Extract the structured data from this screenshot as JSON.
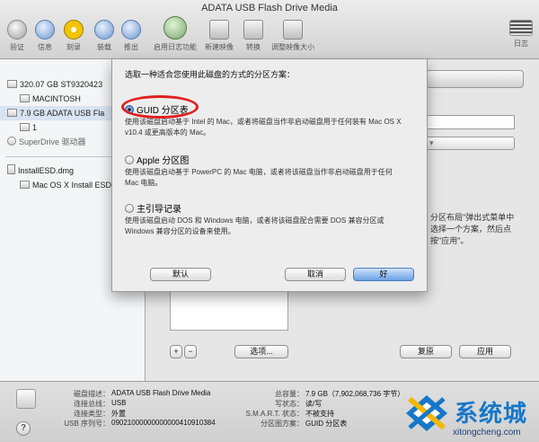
{
  "window": {
    "title": "ADATA USB Flash Drive Media"
  },
  "toolbar": {
    "items": [
      {
        "label": "验证",
        "icon": "microscope-icon"
      },
      {
        "label": "信息",
        "icon": "info-icon"
      },
      {
        "label": "刻录",
        "icon": "burn-icon"
      },
      {
        "label": "装载",
        "icon": "mount-icon"
      },
      {
        "label": "推出",
        "icon": "eject-icon"
      },
      {
        "label": "启用日志功能",
        "icon": "journal-icon"
      },
      {
        "label": "新建映像",
        "icon": "new-image-icon"
      },
      {
        "label": "转换",
        "icon": "convert-icon"
      },
      {
        "label": "调整映像大小",
        "icon": "resize-image-icon"
      }
    ],
    "log_label": "日志"
  },
  "sidebar": {
    "items": [
      {
        "label": "320.07 GB ST9320423",
        "selected": false
      },
      {
        "label": "MACINTOSH",
        "selected": false
      },
      {
        "label": "7.9 GB ADATA USB Fla",
        "selected": true
      },
      {
        "label": "1",
        "selected": false
      },
      {
        "label": "SuperDrive 驱动器",
        "selected": false
      },
      {
        "label": "InstallESD.dmg",
        "selected": false
      },
      {
        "label": "Mac OS X Install ESD",
        "selected": false
      }
    ]
  },
  "main": {
    "options_button": "选项...",
    "revert_button": "复原",
    "apply_button": "应用",
    "add_button": "+",
    "remove_button": "−",
    "hint_text": "分区布局\"弹出式菜单中选择一个方案，然后点按\"应用\"。"
  },
  "sheet": {
    "prompt": "选取一种适合您使用此磁盘的方式的分区方案：",
    "options": [
      {
        "title": "GUID 分区表",
        "selected": true,
        "desc": "使用该磁盘启动基于 Intel 的 Mac，或者将磁盘当作非启动磁盘用于任何装有 Mac OS X v10.4 或更高版本的 Mac。"
      },
      {
        "title": "Apple 分区图",
        "selected": false,
        "desc": "使用该磁盘启动基于 PowerPC 的 Mac 电脑，或者将该磁盘当作非启动磁盘用于任何 Mac 电脑。"
      },
      {
        "title": "主引导记录",
        "selected": false,
        "desc": "使用该磁盘启动 DOS 和 Windows 电脑，或者将该磁盘配合需要 DOS 兼容分区或 Windows 兼容分区的设备来使用。"
      }
    ],
    "default_button": "默认",
    "cancel_button": "取消",
    "ok_button": "好",
    "highlight_color": "#e0201f"
  },
  "info": {
    "left": [
      {
        "label": "磁盘描述：",
        "value": "ADATA USB Flash Drive Media"
      },
      {
        "label": "连接总线：",
        "value": "USB"
      },
      {
        "label": "连接类型：",
        "value": "外置"
      },
      {
        "label": "USB 序列号：",
        "value": "09021000000000000410910384"
      }
    ],
    "right": [
      {
        "label": "总容量：",
        "value": "7.9 GB（7,902,068,736 字节）"
      },
      {
        "label": "写状态：",
        "value": "读/写"
      },
      {
        "label": "S.M.A.R.T. 状态：",
        "value": "不被支持"
      },
      {
        "label": "分区图方案：",
        "value": "GUID 分区表"
      }
    ]
  },
  "watermark": {
    "title": "系统城",
    "url": "xitongcheng.com"
  },
  "colors": {
    "accent": "#3f7fd0",
    "watermark_blue": "#1577c9",
    "watermark_yellow": "#f2b705"
  }
}
